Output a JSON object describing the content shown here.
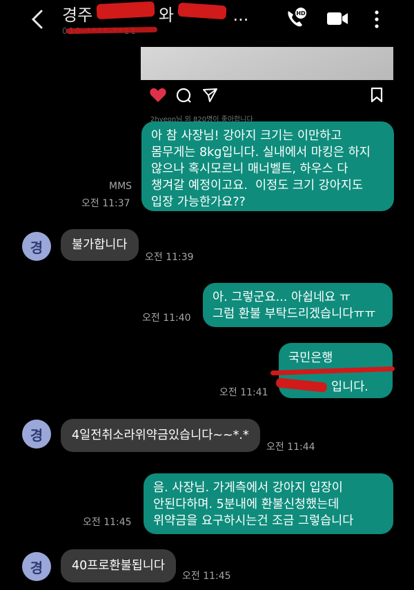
{
  "header": {
    "title_prefix": "경주",
    "title_mid": "와",
    "title_suffix": "...",
    "subtitle": "010-****-**11"
  },
  "shared_post": {
    "likes_text": "2hyeon님 외 820명이 좋아합니다"
  },
  "messages": [
    {
      "dir": "out",
      "text": "아 참 사장님! 강아지 크기는 이만하고\n몸무게는 8kg입니다. 실내에서 마킹은 하지\n않으나 혹시모르니 매너벨트, 하우스 다\n챙겨갈 예정이고요.  이정도 크기 강아지도\n입장 가능한가요??",
      "label": "MMS",
      "time": "오전 11:37"
    },
    {
      "dir": "in",
      "avatar": "경",
      "text": "불가합니다",
      "time": "오전 11:39"
    },
    {
      "dir": "out",
      "text": "아. 그렇군요... 아쉽네요 ㅠ\n그럼 환불 부탁드리겠습니다ㅠㅠ",
      "time": "오전 11:40"
    },
    {
      "dir": "out",
      "text_line1": "국민은행",
      "text_line3": "입니다.",
      "time": "오전 11:41"
    },
    {
      "dir": "in",
      "avatar": "경",
      "text": "4일전취소라위약금있습니다~~*.*",
      "time": "오전 11:44"
    },
    {
      "dir": "out",
      "text": "음. 사장님. 가게측에서 강아지 입장이\n안된다하며. 5분내에 환불신청했는데\n위약금을 요구하시는건 조금 그렇습니다",
      "time": "오전 11:45"
    },
    {
      "dir": "in",
      "avatar": "경",
      "text": "40프로환불됩니다",
      "time": "오전 11:45"
    }
  ],
  "colors": {
    "outgoing_bubble": "#0f8c7c",
    "incoming_bubble": "#3a3a3a",
    "avatar_bg": "#9aa7d8",
    "redaction": "#d11a1a",
    "heart": "#e0314b"
  },
  "icons": [
    "back-arrow-icon",
    "hd-call-icon",
    "video-call-icon",
    "more-vertical-icon",
    "heart-icon",
    "comment-icon",
    "share-icon",
    "bookmark-icon"
  ]
}
